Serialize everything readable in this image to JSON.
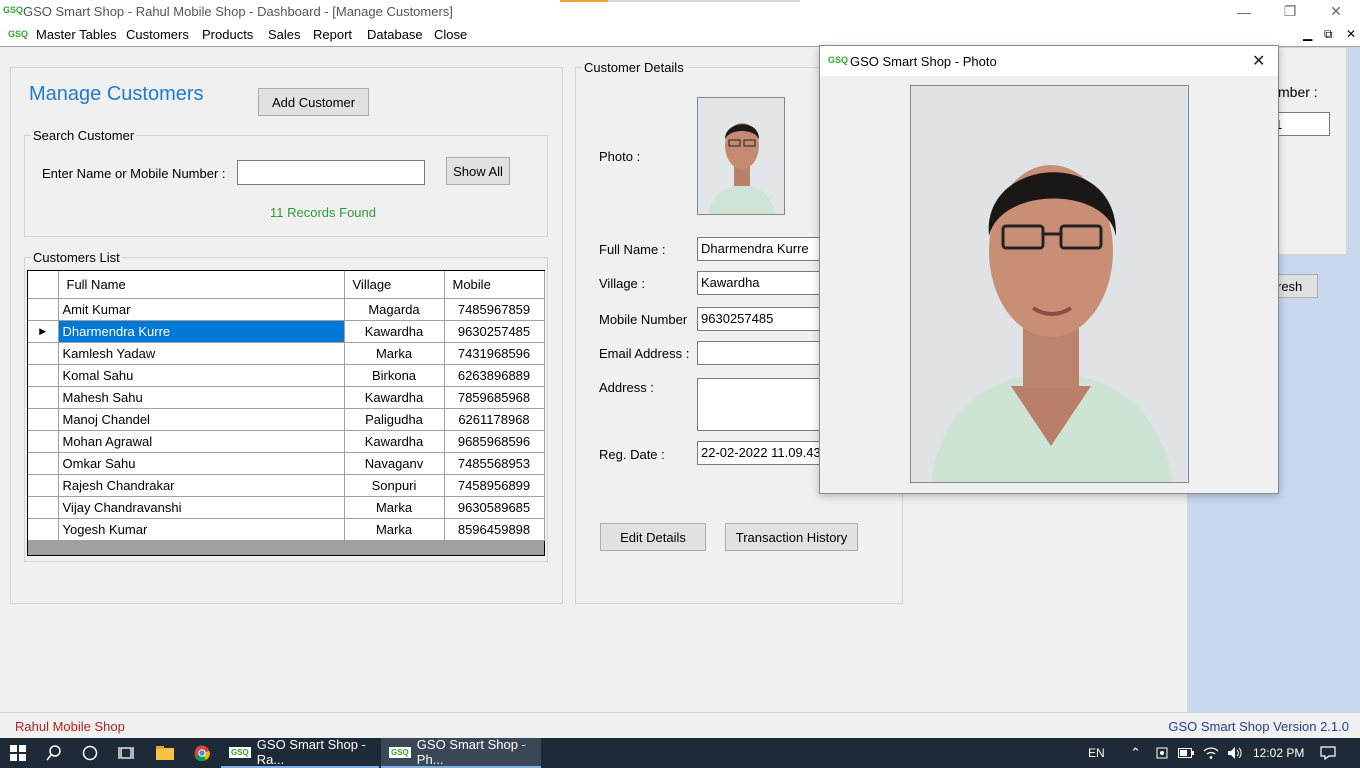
{
  "window": {
    "title": "GSO Smart Shop - Rahul Mobile Shop - Dashboard - [Manage Customers]",
    "logo": "GSQ",
    "minimize": "—",
    "restore": "❐",
    "close": "✕"
  },
  "menu": {
    "items": [
      "Master Tables",
      "Customers",
      "Products",
      "Sales",
      "Report",
      "Database",
      "Close"
    ],
    "mdi_minimize": "▁",
    "mdi_restore": "⧉",
    "mdi_close": "✕"
  },
  "manage": {
    "heading": "Manage Customers",
    "add_button": "Add Customer",
    "search_group": "Search Customer",
    "search_label": "Enter Name or Mobile Number :",
    "search_value": "",
    "show_all_button": "Show All",
    "records_found": "11 Records Found",
    "list_group": "Customers List"
  },
  "grid": {
    "columns": [
      "Full Name",
      "Village",
      "Mobile"
    ],
    "selected_index": 1,
    "row_marker": "▶",
    "rows": [
      {
        "name": "Amit Kumar",
        "village": "Magarda",
        "mobile": "7485967859"
      },
      {
        "name": "Dharmendra Kurre",
        "village": "Kawardha",
        "mobile": "9630257485"
      },
      {
        "name": "Kamlesh Yadaw",
        "village": "Marka",
        "mobile": "7431968596"
      },
      {
        "name": "Komal Sahu",
        "village": "Birkona",
        "mobile": "6263896889"
      },
      {
        "name": "Mahesh Sahu",
        "village": "Kawardha",
        "mobile": "7859685968"
      },
      {
        "name": "Manoj Chandel",
        "village": "Paligudha",
        "mobile": "6261178968"
      },
      {
        "name": "Mohan Agrawal",
        "village": "Kawardha",
        "mobile": "9685968596"
      },
      {
        "name": "Omkar Sahu",
        "village": "Navaganv",
        "mobile": "7485568953"
      },
      {
        "name": "Rajesh Chandrakar",
        "village": "Sonpuri",
        "mobile": "7458956899"
      },
      {
        "name": "Vijay Chandravanshi",
        "village": "Marka",
        "mobile": "9630589685"
      },
      {
        "name": "Yogesh Kumar",
        "village": "Marka",
        "mobile": "8596459898"
      }
    ]
  },
  "details": {
    "group": "Customer Details",
    "photo_label": "Photo :",
    "full_name_label": "Full Name :",
    "full_name": "Dharmendra Kurre",
    "village_label": "Village :",
    "village": "Kawardha",
    "mobile_label": "Mobile Number",
    "mobile": "9630257485",
    "email_label": "Email Address :",
    "email": "",
    "address_label": "Address :",
    "address": "",
    "reg_label": "Reg. Date :",
    "reg_date": "22-02-2022 11.09.43",
    "edit_button": "Edit Details",
    "history_button": "Transaction History"
  },
  "right_panel": {
    "label": "mber :",
    "input_value": "1",
    "button": "resh"
  },
  "photo_window": {
    "title": "GSO Smart Shop - Photo",
    "close": "✕"
  },
  "status": {
    "left": "Rahul Mobile Shop",
    "right": "GSO Smart Shop Version 2.1.0"
  },
  "taskbar": {
    "tasks": [
      "GSO Smart Shop - Ra...",
      "GSO Smart Shop - Ph..."
    ],
    "lang": "EN",
    "time": "12:02 PM"
  },
  "colors": {
    "heading": "#1e7bd1",
    "records": "#2f9a3a",
    "selection": "#0078d7",
    "status_left": "#b22222",
    "status_right": "#1f3f8f",
    "right_panel": "#c7d8ef",
    "taskbar": "#1f2a38"
  }
}
